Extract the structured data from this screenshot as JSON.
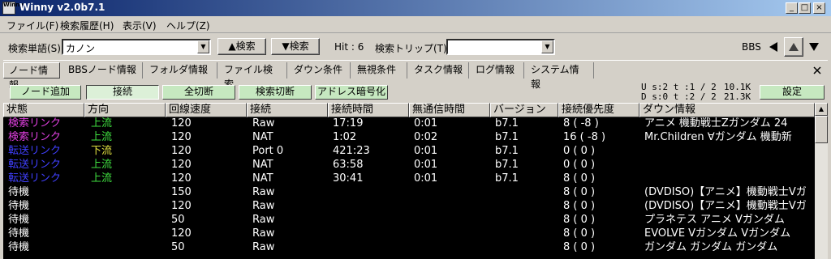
{
  "window": {
    "title": "Winny  v2.0b7.1",
    "icon_text": "Winny",
    "buttons": [
      "_",
      "□",
      "×"
    ]
  },
  "menu": [
    {
      "label": "ファイル(F)"
    },
    {
      "label": "検索履歴(H)"
    },
    {
      "label": "表示(V)"
    },
    {
      "label": "ヘルプ(Z)"
    }
  ],
  "toolbar": {
    "search_label": "検索単語(S)",
    "search_value": "カノン",
    "search_up_label": "▲検索",
    "search_down_label": "▼検索",
    "hit_label": "Hit : 6",
    "trip_label": "検索トリップ(T)",
    "trip_value": "",
    "bbs_label": "BBS"
  },
  "tabs": [
    {
      "label": "ノード情報",
      "active": true
    },
    {
      "label": "BBSノード情報"
    },
    {
      "label": "フォルダ情報"
    },
    {
      "label": "ファイル検索"
    },
    {
      "label": "ダウン条件"
    },
    {
      "label": "無視条件"
    },
    {
      "label": "タスク情報"
    },
    {
      "label": "ログ情報"
    },
    {
      "label": "システム情報"
    }
  ],
  "actions": {
    "add_node": "ノード追加",
    "connect": "接続",
    "disconnect_all": "全切断",
    "search_disconnect": "検索切断",
    "address_encrypt": "アドレス暗号化",
    "settings": "設定"
  },
  "stats": {
    "up_line": "U s:2  t :1 / 2",
    "down_line": "D s:0  t :2 / 2",
    "up_speed": "10.1K",
    "down_speed": "21.3K"
  },
  "table": {
    "columns": [
      "状態",
      "方向",
      "回線速度",
      "接続",
      "接続時間",
      "無通信時間",
      "バージョン",
      "接続優先度",
      "ダウン情報"
    ],
    "rows": [
      {
        "state": "検索リンク",
        "dir": "上流",
        "speed": "120",
        "conn": "Raw",
        "time": "17:19",
        "idle": "0:01",
        "ver": "b7.1",
        "prio": "8 ( -8 )",
        "info": "アニメ 機動戦士Zガンダム 24"
      },
      {
        "state": "検索リンク",
        "dir": "上流",
        "speed": "120",
        "conn": "NAT",
        "time": "1:02",
        "idle": "0:02",
        "ver": "b7.1",
        "prio": "16 ( -8 )",
        "info": "Mr.Children ∀ガンダム 機動新"
      },
      {
        "state": "転送リンク",
        "dir": "下流",
        "speed": "120",
        "conn": "Port 0",
        "time": "421:23",
        "idle": "0:01",
        "ver": "b7.1",
        "prio": "0 ( 0 )",
        "info": ""
      },
      {
        "state": "転送リンク",
        "dir": "上流",
        "speed": "120",
        "conn": "NAT",
        "time": "63:58",
        "idle": "0:01",
        "ver": "b7.1",
        "prio": "0 ( 0 )",
        "info": ""
      },
      {
        "state": "転送リンク",
        "dir": "上流",
        "speed": "120",
        "conn": "NAT",
        "time": "30:41",
        "idle": "0:01",
        "ver": "b7.1",
        "prio": "8 ( 0 )",
        "info": ""
      },
      {
        "state": "待機",
        "dir": "",
        "speed": "150",
        "conn": "Raw",
        "time": "",
        "idle": "",
        "ver": "",
        "prio": "8 ( 0 )",
        "info": "(DVDISO)【アニメ】機動戦士Vガ"
      },
      {
        "state": "待機",
        "dir": "",
        "speed": "120",
        "conn": "Raw",
        "time": "",
        "idle": "",
        "ver": "",
        "prio": "8 ( 0 )",
        "info": "(DVDISO)【アニメ】機動戦士Vガ"
      },
      {
        "state": "待機",
        "dir": "",
        "speed": "50",
        "conn": "Raw",
        "time": "",
        "idle": "",
        "ver": "",
        "prio": "8 ( 0 )",
        "info": "プラネテス アニメ Vガンダム"
      },
      {
        "state": "待機",
        "dir": "",
        "speed": "120",
        "conn": "Raw",
        "time": "",
        "idle": "",
        "ver": "",
        "prio": "8 ( 0 )",
        "info": "EVOLVE Vガンダム Vガンダム"
      },
      {
        "state": "待機",
        "dir": "",
        "speed": "50",
        "conn": "Raw",
        "time": "",
        "idle": "",
        "ver": "",
        "prio": "8 ( 0 )",
        "info": "ガンダム ガンダム ガンダム"
      }
    ]
  },
  "colors": {
    "search_link": "#e040e0",
    "transfer_link": "#4040ff",
    "upstream": "#40e040",
    "downstream": "#e0e040",
    "waiting": "#ffffff",
    "grid_bg": "#000000"
  }
}
